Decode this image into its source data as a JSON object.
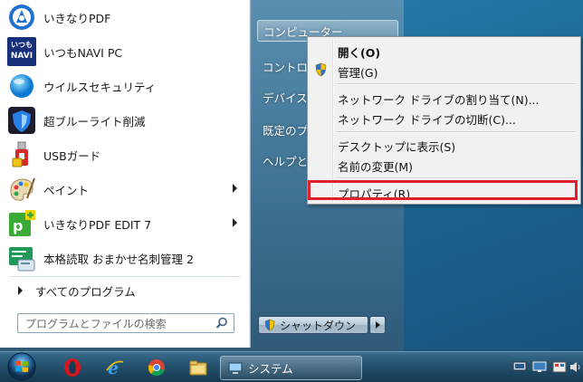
{
  "start_menu": {
    "programs": [
      {
        "label": "いきなりPDF",
        "icon": "ikinari-pdf-icon",
        "has_submenu": false
      },
      {
        "label": "いつもNAVI PC",
        "icon": "itsumo-navi-icon",
        "icon_text_top": "いつも",
        "icon_text_bottom": "NAVI",
        "has_submenu": false
      },
      {
        "label": "ウイルスセキュリティ",
        "icon": "virus-security-icon",
        "has_submenu": false
      },
      {
        "label": "超ブルーライト削減",
        "icon": "blue-light-shield-icon",
        "has_submenu": false
      },
      {
        "label": "USBガード",
        "icon": "usb-guard-icon",
        "has_submenu": false
      },
      {
        "label": "ペイント",
        "icon": "paint-palette-icon",
        "has_submenu": true
      },
      {
        "label": "いきなりPDF EDIT 7",
        "icon": "ikinari-pdf-edit-icon",
        "has_submenu": true
      },
      {
        "label": "本格読取 おまかせ名刺管理 2",
        "icon": "business-card-icon",
        "has_submenu": false
      }
    ],
    "all_programs": "すべてのプログラム",
    "search_placeholder": "プログラムとファイルの検索",
    "right_items": [
      {
        "label": "コンピューター",
        "highlighted": true
      },
      {
        "label": "コントロ",
        "highlighted": false
      },
      {
        "label": "デバイス",
        "highlighted": false
      },
      {
        "label": "既定のプ",
        "highlighted": false
      },
      {
        "label": "ヘルプと",
        "highlighted": false
      }
    ],
    "shutdown_label": "シャットダウン"
  },
  "context_menu": {
    "groups": [
      [
        {
          "label": "開く(O)",
          "bold": true,
          "uac": false
        },
        {
          "label": "管理(G)",
          "bold": false,
          "uac": true
        }
      ],
      [
        {
          "label": "ネットワーク ドライブの割り当て(N)...",
          "bold": false,
          "uac": false
        },
        {
          "label": "ネットワーク ドライブの切断(C)...",
          "bold": false,
          "uac": false
        }
      ],
      [
        {
          "label": "デスクトップに表示(S)",
          "bold": false,
          "uac": false
        },
        {
          "label": "名前の変更(M)",
          "bold": false,
          "uac": false
        }
      ],
      [
        {
          "label": "プロパティ(R)",
          "bold": false,
          "uac": false,
          "marked": true
        }
      ]
    ],
    "highlight_color": "#e0202a"
  },
  "taskbar": {
    "pinned": [
      "opera-icon",
      "internet-explorer-icon",
      "chrome-icon",
      "file-explorer-icon"
    ],
    "active_window_label": "システム",
    "tray_icons": [
      "network-icon",
      "display-icon",
      "action-center-icon",
      "volume-icon"
    ]
  }
}
